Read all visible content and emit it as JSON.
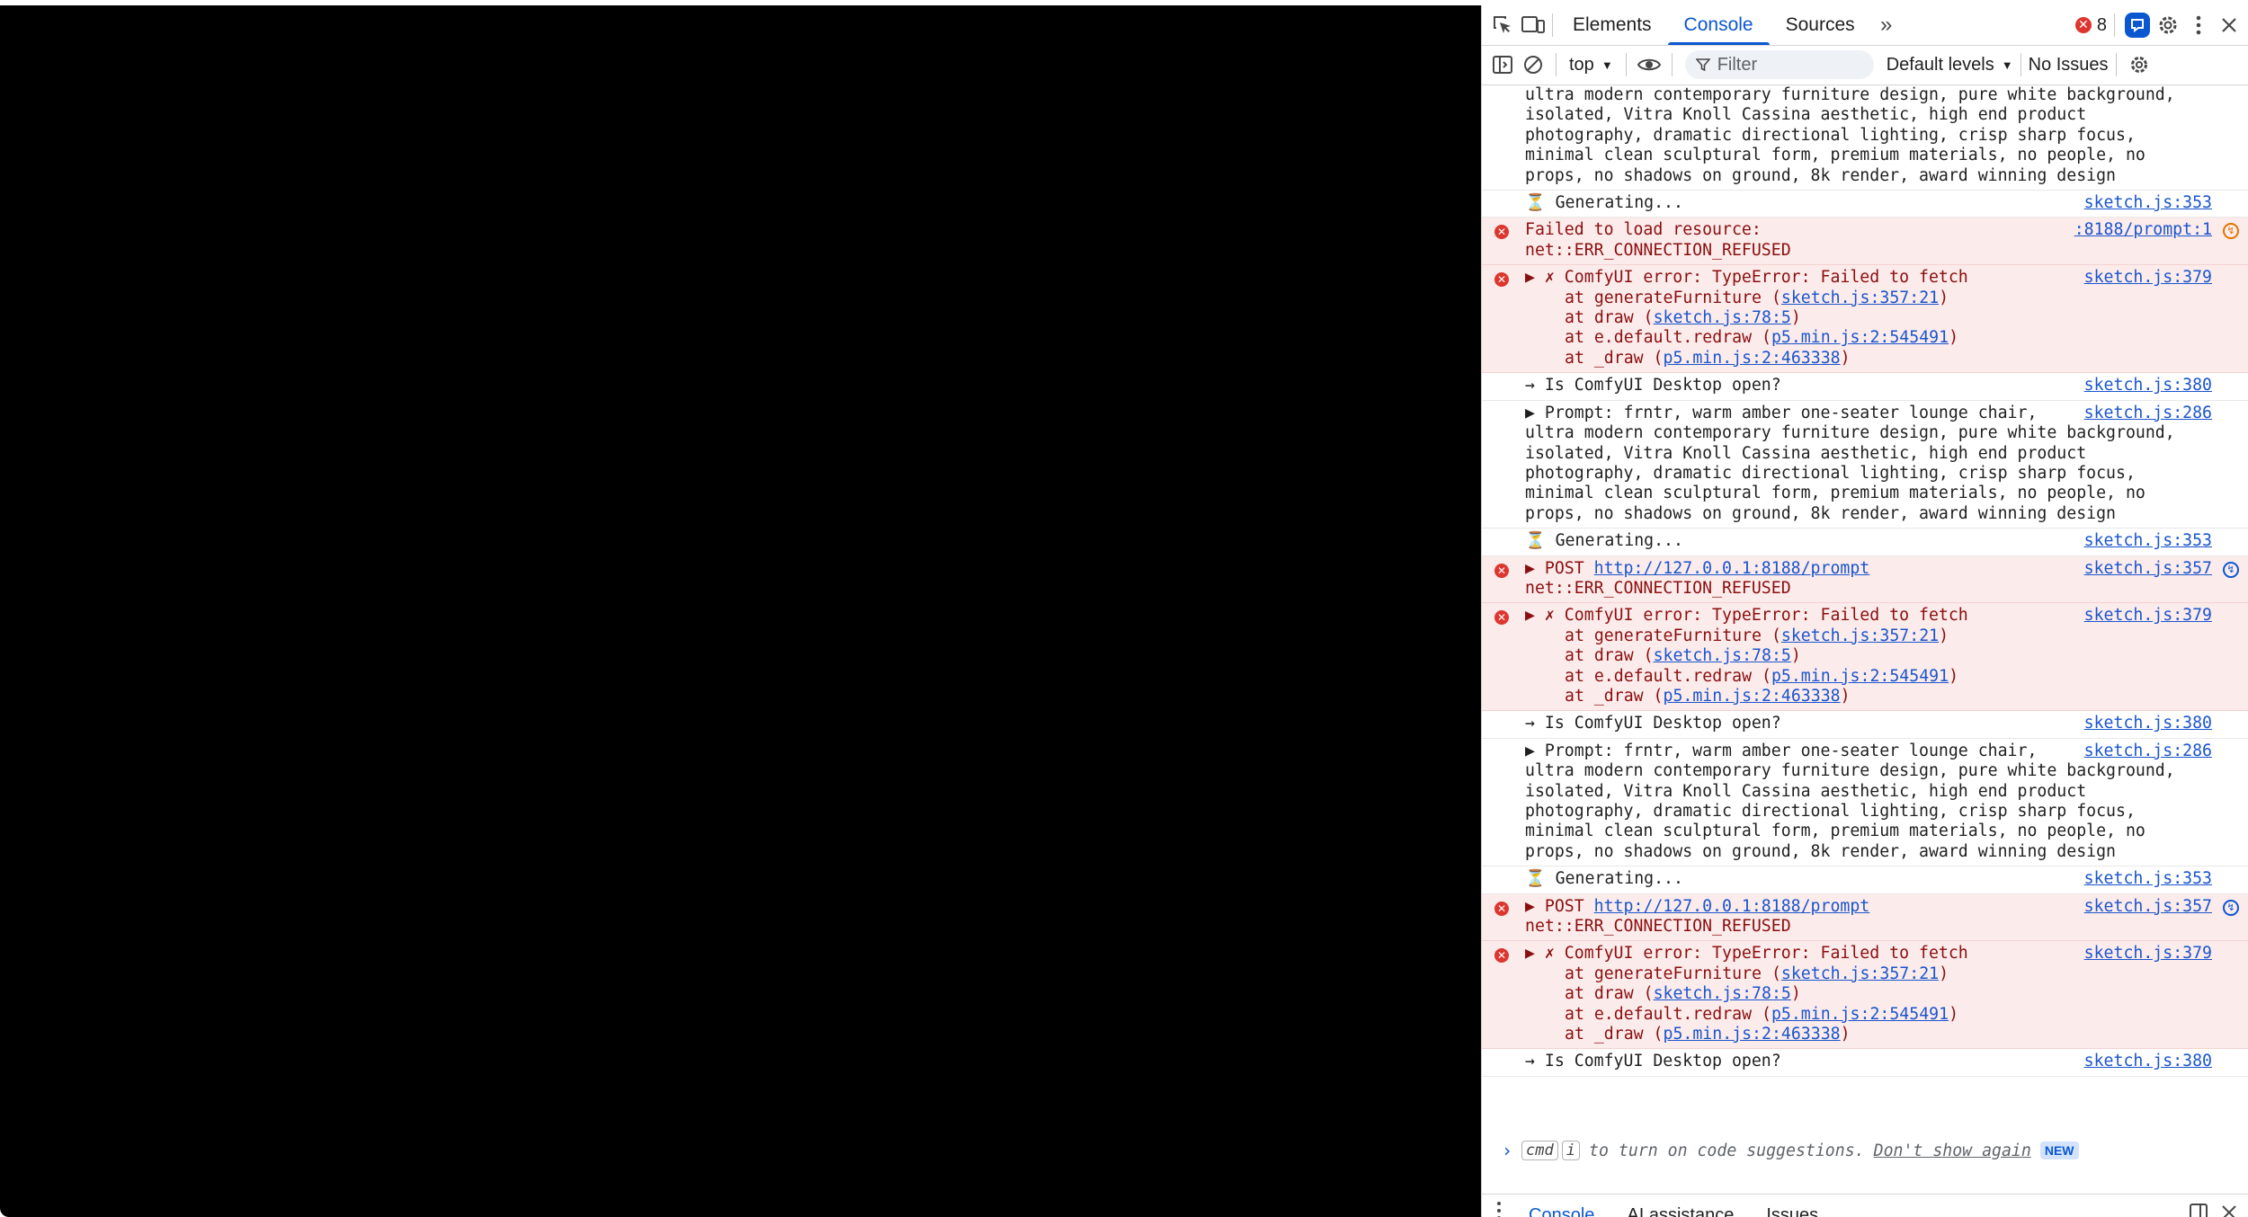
{
  "devtools": {
    "tabs": [
      "Elements",
      "Console",
      "Sources"
    ],
    "active_tab": "Console",
    "more_tabs_glyph": "»",
    "error_count": "8",
    "toolbar": {
      "context": "top",
      "filter_placeholder": "Filter",
      "levels": "Default levels",
      "issues": "No Issues"
    }
  },
  "console": {
    "top_fragment": "ultra modern contemporary furniture design, pure white background,\nisolated, Vitra Knoll Cassina aesthetic, high end product\nphotography, dramatic directional lighting, crisp sharp focus,\nminimal clean sculptural form, premium materials, no people, no\nprops, no shadows on ground, 8k render, award winning design",
    "messages": [
      {
        "kind": "log",
        "text": "⏳ Generating...",
        "src": "sketch.js:353"
      },
      {
        "kind": "error-net",
        "line1": "Failed to load resource:",
        "line2": "net::ERR_CONNECTION_REFUSED",
        "src": ":8188/prompt:1"
      },
      {
        "kind": "error-stack",
        "head": "▶ ✗ ComfyUI error: TypeError: Failed to fetch",
        "src": "sketch.js:379",
        "frames": [
          [
            "at generateFurniture (",
            "sketch.js:357:21",
            ")"
          ],
          [
            "at draw (",
            "sketch.js:78:5",
            ")"
          ],
          [
            "at e.default.redraw (",
            "p5.min.js:2:545491",
            ")"
          ],
          [
            "at _draw (",
            "p5.min.js:2:463338",
            ")"
          ]
        ]
      },
      {
        "kind": "log",
        "text": "→ Is ComfyUI Desktop open?",
        "src": "sketch.js:380"
      },
      {
        "kind": "prompt",
        "text": "▶ Prompt: frntr, warm amber one-seater lounge chair,\nultra modern contemporary furniture design, pure white background,\nisolated, Vitra Knoll Cassina aesthetic, high end product\nphotography, dramatic directional lighting, crisp sharp focus,\nminimal clean sculptural form, premium materials, no people, no\nprops, no shadows on ground, 8k render, award winning design",
        "src": "sketch.js:286"
      },
      {
        "kind": "log",
        "text": "⏳ Generating...",
        "src": "sketch.js:353"
      },
      {
        "kind": "error-post",
        "prefix": "▶ POST ",
        "url": "http://127.0.0.1:8188/prompt",
        "line2": "net::ERR_CONNECTION_REFUSED",
        "src": "sketch.js:357"
      },
      {
        "kind": "error-stack",
        "head": "▶ ✗ ComfyUI error: TypeError: Failed to fetch",
        "src": "sketch.js:379",
        "frames": [
          [
            "at generateFurniture (",
            "sketch.js:357:21",
            ")"
          ],
          [
            "at draw (",
            "sketch.js:78:5",
            ")"
          ],
          [
            "at e.default.redraw (",
            "p5.min.js:2:545491",
            ")"
          ],
          [
            "at _draw (",
            "p5.min.js:2:463338",
            ")"
          ]
        ]
      },
      {
        "kind": "log",
        "text": "→ Is ComfyUI Desktop open?",
        "src": "sketch.js:380"
      },
      {
        "kind": "prompt",
        "text": "▶ Prompt: frntr, warm amber one-seater lounge chair,\nultra modern contemporary furniture design, pure white background,\nisolated, Vitra Knoll Cassina aesthetic, high end product\nphotography, dramatic directional lighting, crisp sharp focus,\nminimal clean sculptural form, premium materials, no people, no\nprops, no shadows on ground, 8k render, award winning design",
        "src": "sketch.js:286"
      },
      {
        "kind": "log",
        "text": "⏳ Generating...",
        "src": "sketch.js:353"
      },
      {
        "kind": "error-post",
        "prefix": "▶ POST ",
        "url": "http://127.0.0.1:8188/prompt",
        "line2": "net::ERR_CONNECTION_REFUSED",
        "src": "sketch.js:357"
      },
      {
        "kind": "error-stack",
        "head": "▶ ✗ ComfyUI error: TypeError: Failed to fetch",
        "src": "sketch.js:379",
        "frames": [
          [
            "at generateFurniture (",
            "sketch.js:357:21",
            ")"
          ],
          [
            "at draw (",
            "sketch.js:78:5",
            ")"
          ],
          [
            "at e.default.redraw (",
            "p5.min.js:2:545491",
            ")"
          ],
          [
            "at _draw (",
            "p5.min.js:2:463338",
            ")"
          ]
        ]
      },
      {
        "kind": "log",
        "text": "→ Is ComfyUI Desktop open?",
        "src": "sketch.js:380"
      }
    ],
    "prompt": {
      "kbd1": "cmd",
      "kbd2": "i",
      "text": "to turn on code suggestions.",
      "dismiss": "Don't show again",
      "badge": "NEW"
    }
  },
  "drawer": {
    "tabs": [
      "Console",
      "AI assistance",
      "Issues"
    ],
    "active_tab": "Console"
  },
  "colors": {
    "accent": "#0b57d0",
    "error_bg": "#fcebeb",
    "error_text": "#8b0e0e",
    "error_icon": "#dc362e",
    "canvas": "#000000"
  }
}
